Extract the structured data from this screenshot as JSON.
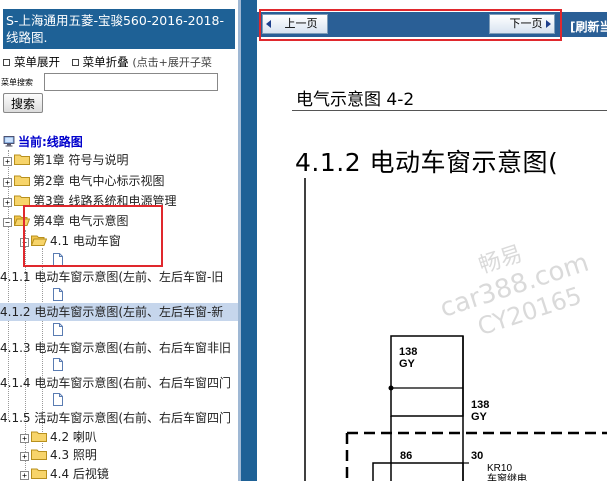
{
  "left_panel": {
    "title": "S-上海通用五菱-宝骏560-2016-2018- 线路图.",
    "menu_expand": "菜单展开",
    "menu_collapse": "菜单折叠",
    "menu_hint": "(点击+展开子菜",
    "search_label": "菜单搜索",
    "search_value": "",
    "search_button": "搜索",
    "current_label": "当前:线路图",
    "tree": [
      {
        "label": "第1章 符号与说明",
        "sign": "+"
      },
      {
        "label": "第2章 电气中心标示视图",
        "sign": "+"
      },
      {
        "label": "第3章 线路系统和电源管理",
        "sign": "+"
      },
      {
        "label": "第4章 电气示意图",
        "sign": "−"
      },
      {
        "label": "4.1 电动车窗",
        "sign": "+"
      },
      {
        "label": "4.1.1 电动车窗示意图(左前、左后车窗-旧"
      },
      {
        "label": "4.1.2 电动车窗示意图(左前、左后车窗-新"
      },
      {
        "label": "4.1.3 电动车窗示意图(右前、右后车窗非旧"
      },
      {
        "label": "4.1.4 电动车窗示意图(右前、右后车窗四门"
      },
      {
        "label": "4.1.5 活动车窗示意图(右前、右后车窗四门"
      },
      {
        "label": "4.2 喇叭",
        "sign": "+"
      },
      {
        "label": "4.3 照明",
        "sign": "+"
      },
      {
        "label": "4.4 后视镜",
        "sign": "+"
      }
    ]
  },
  "nav": {
    "prev_label": "上一页",
    "next_label": "下一页",
    "refresh_label": "[刷新当"
  },
  "document": {
    "title": "电气示意图 4-2",
    "heading": "4.1.2 电动车窗示意图(",
    "diagram": {
      "labels": [
        "138",
        "GY",
        "138",
        "GY",
        "86",
        "30",
        "KR10",
        "车窗继电"
      ]
    },
    "watermark": [
      "畅易",
      "car388.com",
      "CY20165"
    ]
  },
  "colors": {
    "title_bar": "#1e6196",
    "separator": "#1e6196",
    "nav_bar": "#2a5f96",
    "highlight_border": "#e0282d",
    "selected_row": "#c6d6ec",
    "current_label": "#0000cc"
  }
}
